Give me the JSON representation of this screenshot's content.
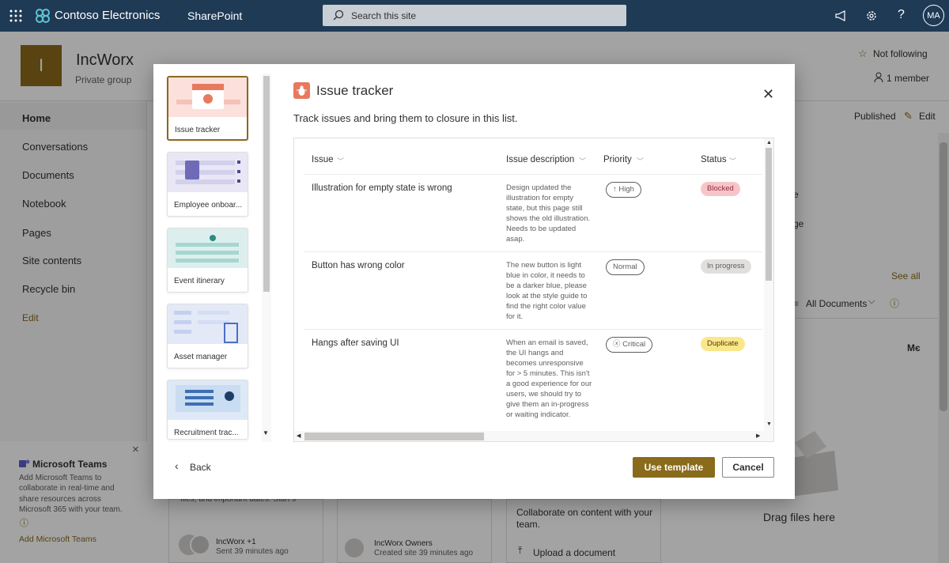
{
  "topbar": {
    "brand": "Contoso Electronics",
    "app": "SharePoint",
    "search_placeholder": "Search this site",
    "avatar": "MA",
    "icons": [
      "waffle-icon",
      "megaphone-icon",
      "gear-icon",
      "help-icon"
    ]
  },
  "site": {
    "logo_letter": "I",
    "name": "IncWorx",
    "subtitle": "Private group",
    "follow": "Not following",
    "members": "1 member",
    "published": "Published",
    "edit": "Edit"
  },
  "nav": {
    "items": [
      "Home",
      "Conversations",
      "Documents",
      "Notebook",
      "Pages",
      "Site contents",
      "Recycle bin"
    ],
    "edit": "Edit"
  },
  "teams_panel": {
    "title": "Microsoft Teams",
    "body": "Add Microsoft Teams to collaborate in real-time and share resources across Microsoft 365 with your team.",
    "link": "Add Microsoft Teams"
  },
  "background": {
    "see_all": "See all",
    "all_documents": "All Documents",
    "fragment_e": "e",
    "fragment_ge": "ge",
    "fragment_me": "Mє",
    "files_fragment": "files, and important dates. Start s",
    "activity1_name": "IncWorx +1",
    "activity1_time": "Sent 39 minutes ago",
    "activity2_name": "IncWorx Owners",
    "activity2_time": "Created site 39 minutes ago",
    "collab_text": "Collaborate on content with your team.",
    "upload": "Upload a document",
    "drag": "Drag files here"
  },
  "dialog": {
    "templates": [
      {
        "label": "Issue tracker"
      },
      {
        "label": "Employee onboar..."
      },
      {
        "label": "Event itinerary"
      },
      {
        "label": "Asset manager"
      },
      {
        "label": "Recruitment trac..."
      }
    ],
    "title": "Issue tracker",
    "description": "Track issues and bring them to closure in this list.",
    "columns": [
      "Issue",
      "Issue description",
      "Priority",
      "Status"
    ],
    "rows": [
      {
        "issue": "Illustration for empty state is wrong",
        "description": "Design updated the illustration for empty state, but this page still shows the old illustration. Needs to be updated asap.",
        "priority": "High",
        "status": "Blocked"
      },
      {
        "issue": "Button has wrong color",
        "description": "The new button is light blue in color, it needs to be a darker blue, please look at the style guide to find the right color value for it.",
        "priority": "Normal",
        "status": "In progress"
      },
      {
        "issue": "Hangs after saving UI",
        "description": "When an email is saved, the UI hangs and becomes unresponsive for > 5 minutes. This isn't a good experience for our users, we should try to give them an in-progress or waiting indicator.",
        "priority": "Critical",
        "status": "Duplicate"
      }
    ],
    "back": "Back",
    "use_template": "Use template",
    "cancel": "Cancel",
    "accent_color": "#8a6a1b"
  }
}
